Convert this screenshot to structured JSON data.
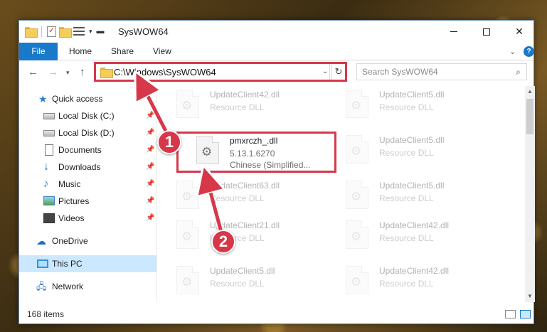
{
  "window": {
    "title": "SysWOW64"
  },
  "ribbon": {
    "tabs": [
      "File",
      "Home",
      "Share",
      "View"
    ],
    "help_label": "?"
  },
  "address": {
    "path": "C:\\Windows\\SysWOW64",
    "search_placeholder": "Search SysWOW64"
  },
  "nav": {
    "items": [
      {
        "label": "Quick access",
        "icon": "star-icon",
        "pinned": false
      },
      {
        "label": "Local Disk (C:)",
        "icon": "drive-icon",
        "pinned": true
      },
      {
        "label": "Local Disk (D:)",
        "icon": "drive-icon",
        "pinned": true
      },
      {
        "label": "Documents",
        "icon": "documents-icon",
        "pinned": true
      },
      {
        "label": "Downloads",
        "icon": "download-icon",
        "pinned": true
      },
      {
        "label": "Music",
        "icon": "music-icon",
        "pinned": true
      },
      {
        "label": "Pictures",
        "icon": "pictures-icon",
        "pinned": true
      },
      {
        "label": "Videos",
        "icon": "videos-icon",
        "pinned": true
      },
      {
        "label": "OneDrive",
        "icon": "onedrive-icon",
        "pinned": false
      },
      {
        "label": "This PC",
        "icon": "this-pc-icon",
        "pinned": false,
        "selected": true
      },
      {
        "label": "Network",
        "icon": "network-icon",
        "pinned": false
      }
    ]
  },
  "files": {
    "items": [
      {
        "name": "UpdateClient42.dll",
        "type": "Resource DLL"
      },
      {
        "name": "UpdateClient5.dll",
        "type": "Resource DLL"
      },
      {
        "name": "pmxrczh_.dll",
        "version": "5.13.1.6270",
        "language": "Chinese (Simplified...",
        "selected": true
      },
      {
        "name": "UpdateClient5.dll",
        "type": "Resource DLL"
      },
      {
        "name": "UpdateClient63.dll",
        "type": "Resource DLL"
      },
      {
        "name": "UpdateClient5.dll",
        "type": "Resource DLL"
      },
      {
        "name": "UpdateClient21.dll",
        "type": "Resource DLL"
      },
      {
        "name": "UpdateClient42.dll",
        "type": "Resource DLL"
      },
      {
        "name": "UpdateClient5.dll",
        "type": "Resource DLL"
      },
      {
        "name": "UpdateClient42.dll",
        "type": "Resource DLL"
      }
    ]
  },
  "status": {
    "item_count": "168 items"
  },
  "annotations": {
    "badge_1": "1",
    "badge_2": "2",
    "color": "#d6384a"
  }
}
